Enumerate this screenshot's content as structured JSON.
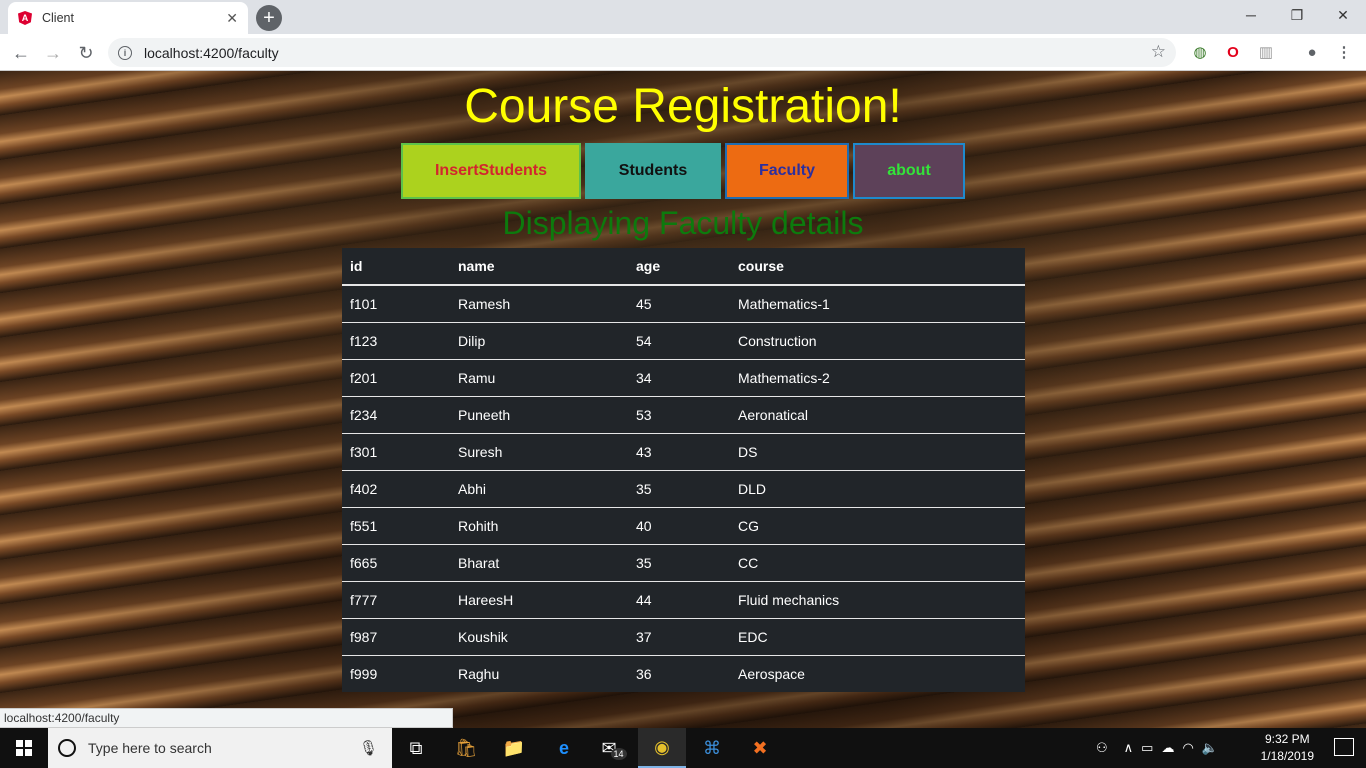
{
  "browser": {
    "tab_title": "Client",
    "tab_close": "✕",
    "newtab": "+",
    "url": "localhost:4200/faculty",
    "status_url": "localhost:4200/faculty"
  },
  "page": {
    "title": "Course Registration!",
    "nav": {
      "insert": "InsertStudents",
      "students": "Students",
      "faculty": "Faculty",
      "about": "about"
    },
    "subtitle": "Displaying Faculty details",
    "table": {
      "headers": [
        "id",
        "name",
        "age",
        "course"
      ],
      "rows": [
        [
          "f101",
          "Ramesh",
          "45",
          "Mathematics-1"
        ],
        [
          "f123",
          "Dilip",
          "54",
          "Construction"
        ],
        [
          "f201",
          "Ramu",
          "34",
          "Mathematics-2"
        ],
        [
          "f234",
          "Puneeth",
          "53",
          "Aeronatical"
        ],
        [
          "f301",
          "Suresh",
          "43",
          "DS"
        ],
        [
          "f402",
          "Abhi",
          "35",
          "DLD"
        ],
        [
          "f551",
          "Rohith",
          "40",
          "CG"
        ],
        [
          "f665",
          "Bharat",
          "35",
          "CC"
        ],
        [
          "f777",
          "HareesH",
          "44",
          "Fluid mechanics"
        ],
        [
          "f987",
          "Koushik",
          "37",
          "EDC"
        ],
        [
          "f999",
          "Raghu",
          "36",
          "Aerospace"
        ]
      ]
    }
  },
  "taskbar": {
    "search_placeholder": "Type here to search",
    "mail_badge": "14",
    "time": "9:32 PM",
    "date": "1/18/2019"
  },
  "colors": {
    "title": "#ffff00",
    "subtitle": "#0d7a0d",
    "table_bg": "#212529"
  }
}
